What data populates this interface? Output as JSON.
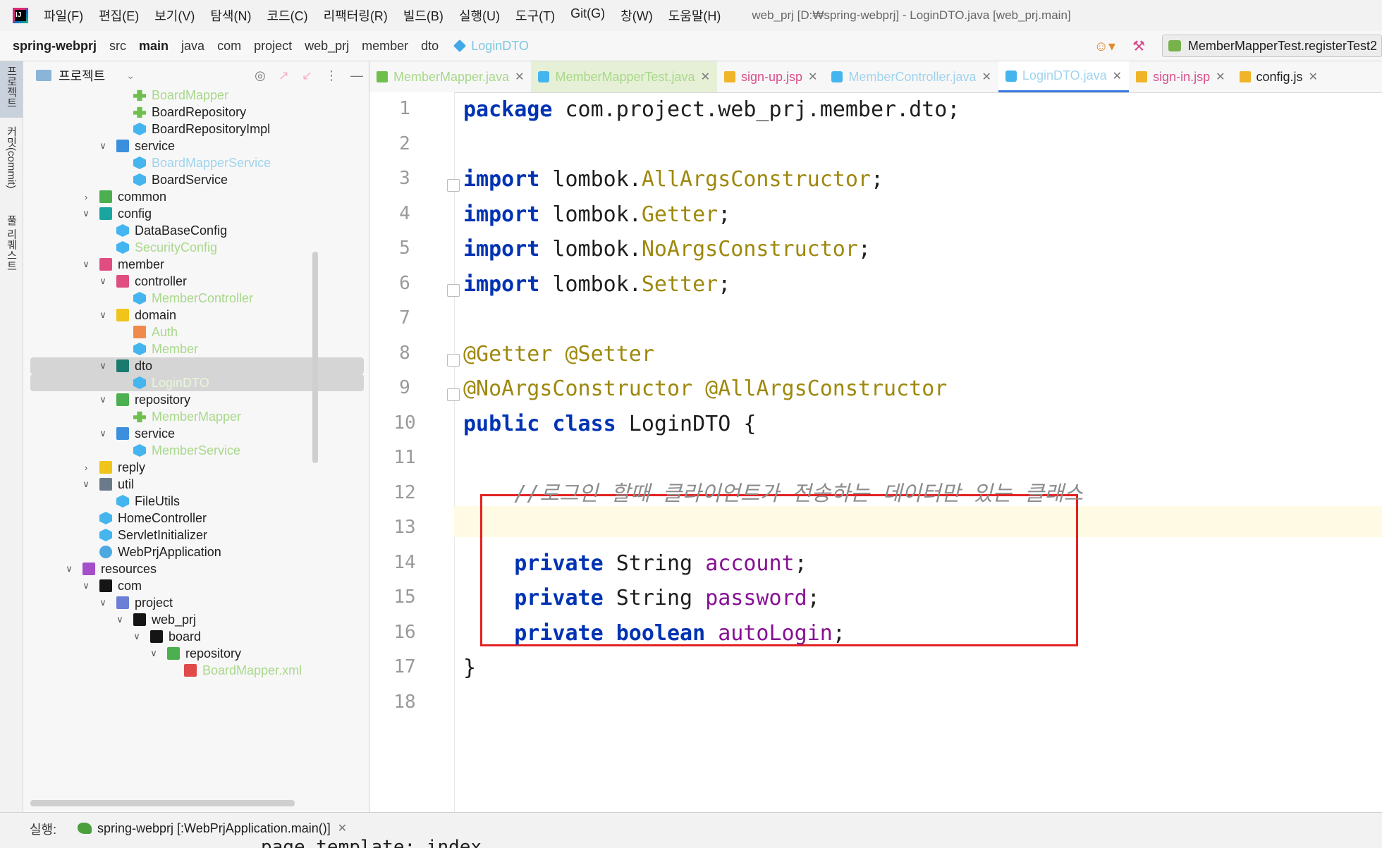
{
  "menubar": {
    "items": [
      "파일(F)",
      "편집(E)",
      "보기(V)",
      "탐색(N)",
      "코드(C)",
      "리팩터링(R)",
      "빌드(B)",
      "실행(U)",
      "도구(T)",
      "Git(G)",
      "창(W)",
      "도움말(H)"
    ],
    "window_title": "web_prj [D:₩spring-webprj] - LoginDTO.java [web_prj.main]"
  },
  "navbar": {
    "crumbs": [
      "spring-webprj",
      "src",
      "main",
      "java",
      "com",
      "project",
      "web_prj",
      "member",
      "dto",
      "LoginDTO"
    ],
    "run_config": "MemberMapperTest.registerTest2"
  },
  "toolstrip": {
    "project_label": "프로젝트",
    "commit_label": "커밋(commit)",
    "pr_label": "풀 리퀘스트"
  },
  "project_panel": {
    "title": "프로젝트",
    "tree": [
      {
        "label": "BoardMapper",
        "icon": "iface",
        "indent": 3,
        "twisty": "none",
        "style": "faded"
      },
      {
        "label": "BoardRepository",
        "icon": "iface",
        "indent": 3,
        "twisty": "none",
        "style": ""
      },
      {
        "label": "BoardRepositoryImpl",
        "icon": "java",
        "indent": 3,
        "twisty": "none",
        "style": ""
      },
      {
        "label": "service",
        "icon": "pkg-blue",
        "indent": 2,
        "twisty": "open",
        "style": ""
      },
      {
        "label": "BoardMapperService",
        "icon": "java",
        "indent": 3,
        "twisty": "none",
        "style": "faded-blue"
      },
      {
        "label": "BoardService",
        "icon": "java",
        "indent": 3,
        "twisty": "none",
        "style": ""
      },
      {
        "label": "common",
        "icon": "pkg-green",
        "indent": 1,
        "twisty": "closed",
        "style": ""
      },
      {
        "label": "config",
        "icon": "pkg-teal",
        "indent": 1,
        "twisty": "open",
        "style": ""
      },
      {
        "label": "DataBaseConfig",
        "icon": "java",
        "indent": 2,
        "twisty": "none",
        "style": ""
      },
      {
        "label": "SecurityConfig",
        "icon": "java",
        "indent": 2,
        "twisty": "none",
        "style": "faded"
      },
      {
        "label": "member",
        "icon": "pkg-pink",
        "indent": 1,
        "twisty": "open",
        "style": ""
      },
      {
        "label": "controller",
        "icon": "pkg-pink",
        "indent": 2,
        "twisty": "open",
        "style": ""
      },
      {
        "label": "MemberController",
        "icon": "java",
        "indent": 3,
        "twisty": "none",
        "style": "faded"
      },
      {
        "label": "domain",
        "icon": "pkg-yellow",
        "indent": 2,
        "twisty": "open",
        "style": ""
      },
      {
        "label": "Auth",
        "icon": "enum",
        "indent": 3,
        "twisty": "none",
        "style": "faded"
      },
      {
        "label": "Member",
        "icon": "java",
        "indent": 3,
        "twisty": "none",
        "style": "faded"
      },
      {
        "label": "dto",
        "icon": "pkg-darkteal",
        "indent": 2,
        "twisty": "open",
        "style": "",
        "selected": true
      },
      {
        "label": "LoginDTO",
        "icon": "java",
        "indent": 3,
        "twisty": "none",
        "style": "faded-white",
        "selected": true
      },
      {
        "label": "repository",
        "icon": "pkg-green",
        "indent": 2,
        "twisty": "open",
        "style": ""
      },
      {
        "label": "MemberMapper",
        "icon": "iface",
        "indent": 3,
        "twisty": "none",
        "style": "faded"
      },
      {
        "label": "service",
        "icon": "pkg-blue",
        "indent": 2,
        "twisty": "open",
        "style": ""
      },
      {
        "label": "MemberService",
        "icon": "java",
        "indent": 3,
        "twisty": "none",
        "style": "faded"
      },
      {
        "label": "reply",
        "icon": "pkg-yellow",
        "indent": 1,
        "twisty": "closed",
        "style": ""
      },
      {
        "label": "util",
        "icon": "pkg-gray",
        "indent": 1,
        "twisty": "open",
        "style": ""
      },
      {
        "label": "FileUtils",
        "icon": "java",
        "indent": 2,
        "twisty": "none",
        "style": ""
      },
      {
        "label": "HomeController",
        "icon": "java",
        "indent": 1,
        "twisty": "none",
        "style": ""
      },
      {
        "label": "ServletInitializer",
        "icon": "java",
        "indent": 1,
        "twisty": "none",
        "style": ""
      },
      {
        "label": "WebPrjApplication",
        "icon": "spring",
        "indent": 1,
        "twisty": "none",
        "style": ""
      },
      {
        "label": "resources",
        "icon": "pkg-purple",
        "indent": 0,
        "twisty": "open",
        "style": ""
      },
      {
        "label": "com",
        "icon": "pkg-black",
        "indent": 1,
        "twisty": "open",
        "style": ""
      },
      {
        "label": "project",
        "icon": "pkg-indigo",
        "indent": 2,
        "twisty": "open",
        "style": ""
      },
      {
        "label": "web_prj",
        "icon": "pkg-black",
        "indent": 3,
        "twisty": "open",
        "style": ""
      },
      {
        "label": "board",
        "icon": "pkg-black",
        "indent": 4,
        "twisty": "open",
        "style": ""
      },
      {
        "label": "repository",
        "icon": "pkg-green",
        "indent": 5,
        "twisty": "open",
        "style": ""
      },
      {
        "label": "BoardMapper.xml",
        "icon": "xml",
        "indent": 6,
        "twisty": "none",
        "style": "faded"
      }
    ]
  },
  "editor": {
    "tabs": [
      {
        "label": "MemberMapper.java",
        "kind": "mapper",
        "icon": "iface"
      },
      {
        "label": "MemberMapperTest.java",
        "kind": "selected-dim",
        "icon": "java"
      },
      {
        "label": "sign-up.jsp",
        "kind": "jsp",
        "icon": "jsp"
      },
      {
        "label": "MemberController.java",
        "kind": "ctrl",
        "icon": "java"
      },
      {
        "label": "LoginDTO.java",
        "kind": "active",
        "icon": "java"
      },
      {
        "label": "sign-in.jsp",
        "kind": "jsp",
        "icon": "jsp"
      },
      {
        "label": "config.js",
        "kind": "configjs",
        "icon": "js"
      }
    ],
    "current_line": 12,
    "lines": [
      [
        {
          "t": "package",
          "c": "kw"
        },
        {
          "t": " com.project.web_prj.member.dto;",
          "c": ""
        }
      ],
      [],
      [
        {
          "t": "import",
          "c": "kw"
        },
        {
          "t": " lombok.",
          "c": ""
        },
        {
          "t": "AllArgsConstructor",
          "c": "cls-ref"
        },
        {
          "t": ";",
          "c": ""
        }
      ],
      [
        {
          "t": "import",
          "c": "kw"
        },
        {
          "t": " lombok.",
          "c": ""
        },
        {
          "t": "Getter",
          "c": "cls-ref"
        },
        {
          "t": ";",
          "c": ""
        }
      ],
      [
        {
          "t": "import",
          "c": "kw"
        },
        {
          "t": " lombok.",
          "c": ""
        },
        {
          "t": "NoArgsConstructor",
          "c": "cls-ref"
        },
        {
          "t": ";",
          "c": ""
        }
      ],
      [
        {
          "t": "import",
          "c": "kw"
        },
        {
          "t": " lombok.",
          "c": ""
        },
        {
          "t": "Setter",
          "c": "cls-ref"
        },
        {
          "t": ";",
          "c": ""
        }
      ],
      [],
      [
        {
          "t": "@Getter @Setter",
          "c": "ann"
        }
      ],
      [
        {
          "t": "@NoArgsConstructor @AllArgsConstructor",
          "c": "ann"
        }
      ],
      [
        {
          "t": "public",
          "c": "kw"
        },
        {
          "t": " ",
          "c": ""
        },
        {
          "t": "class",
          "c": "kw"
        },
        {
          "t": " LoginDTO {",
          "c": ""
        }
      ],
      [],
      [
        {
          "t": "    //로그인 할때 클라이언트가 전송하는 데이터만 있는 클래스",
          "c": "comment"
        }
      ],
      [],
      [
        {
          "t": "    ",
          "c": ""
        },
        {
          "t": "private",
          "c": "kw"
        },
        {
          "t": " String ",
          "c": ""
        },
        {
          "t": "account",
          "c": "field"
        },
        {
          "t": ";",
          "c": ""
        }
      ],
      [
        {
          "t": "    ",
          "c": ""
        },
        {
          "t": "private",
          "c": "kw"
        },
        {
          "t": " String ",
          "c": ""
        },
        {
          "t": "password",
          "c": "field"
        },
        {
          "t": ";",
          "c": ""
        }
      ],
      [
        {
          "t": "    ",
          "c": ""
        },
        {
          "t": "private",
          "c": "kw"
        },
        {
          "t": " ",
          "c": ""
        },
        {
          "t": "boolean",
          "c": "kw"
        },
        {
          "t": " ",
          "c": ""
        },
        {
          "t": "autoLogin",
          "c": "field"
        },
        {
          "t": ";",
          "c": ""
        }
      ],
      [
        {
          "t": "}",
          "c": ""
        }
      ],
      []
    ]
  },
  "runbar": {
    "label": "실행:",
    "tab_label": "spring-webprj [:WebPrjApplication.main()]",
    "console_peek": "page template: index"
  }
}
